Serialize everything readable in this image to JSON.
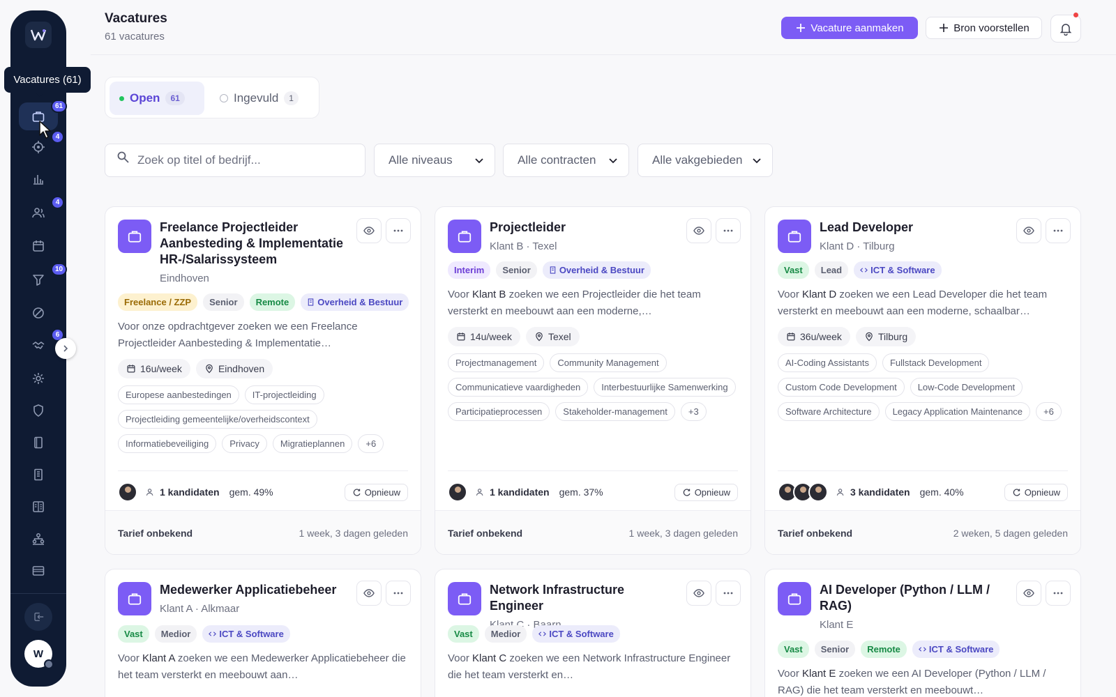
{
  "tooltip": "Vacatures (61)",
  "sidebar": {
    "logo_icon": "w-logo-icon",
    "items": [
      {
        "name": "briefcase-icon",
        "badge": "61",
        "active": true
      },
      {
        "name": "target-icon",
        "badge": "4"
      },
      {
        "name": "chart-icon",
        "badge": ""
      },
      {
        "name": "users-icon",
        "badge": "4"
      },
      {
        "name": "calendar-icon",
        "badge": ""
      },
      {
        "name": "filter-icon",
        "badge": "10"
      },
      {
        "name": "ban-icon",
        "badge": ""
      },
      {
        "name": "handshake-icon",
        "badge": "6"
      },
      {
        "name": "gear-icon",
        "badge": ""
      },
      {
        "name": "shield-icon",
        "badge": ""
      },
      {
        "name": "book-icon",
        "badge": ""
      },
      {
        "name": "building-icon",
        "badge": ""
      },
      {
        "name": "document-icon",
        "badge": ""
      },
      {
        "name": "org-icon",
        "badge": ""
      },
      {
        "name": "card-icon",
        "badge": ""
      }
    ],
    "avatar_letter": "W"
  },
  "header": {
    "title": "Vacatures",
    "subtitle": "61 vacatures",
    "primary_button": "Vacature aanmaken",
    "secondary_button": "Bron voorstellen"
  },
  "tabs": [
    {
      "label": "Open",
      "count": "61"
    },
    {
      "label": "Ingevuld",
      "count": "1"
    }
  ],
  "filters": {
    "search_placeholder": "Zoek op titel of bedrijf...",
    "level": "Alle niveaus",
    "contract": "Alle contracten",
    "domain": "Alle vakgebieden"
  },
  "cards": [
    {
      "title": "Freelance Projectleider Aanbesteding & Implementatie HR-/Salarissysteem",
      "subtitle": "Eindhoven",
      "tags": [
        "Freelance / ZZP",
        "Senior",
        "Remote",
        "Overheid & Bestuur"
      ],
      "desc_prefix": "Voor onze opdrachtgever zoeken we een Freelance Projectleider Aanbesteding & Implementatie…",
      "hours": "16u/week",
      "location": "Eindhoven",
      "skills": [
        "Europese aanbestedingen",
        "IT-projectleiding",
        "Projectleiding gemeentelijke/overheidscontext",
        "Informatiebeveiliging",
        "Privacy",
        "Migratieplannen",
        "+6"
      ],
      "candidates": "1 kandidaten",
      "avg": "gem. 49%",
      "retry": "Opnieuw",
      "tarief": "Tarief onbekend",
      "ago": "1 week, 3 dagen geleden"
    },
    {
      "title": "Projectleider",
      "subtitle": "Klant B · Texel",
      "tags": [
        "Interim",
        "Senior",
        "Overheid & Bestuur"
      ],
      "desc_lead": "Voor ",
      "desc_client": "Klant B",
      "desc_rest": " zoeken we een Projectleider die het team versterkt en meebouwt aan een moderne,…",
      "hours": "14u/week",
      "location": "Texel",
      "skills": [
        "Projectmanagement",
        "Community Management",
        "Communicatieve vaardigheden",
        "Interbestuurlijke Samenwerking",
        "Participatieprocessen",
        "Stakeholder-management",
        "+3"
      ],
      "candidates": "1 kandidaten",
      "avg": "gem. 37%",
      "retry": "Opnieuw",
      "tarief": "Tarief onbekend",
      "ago": "1 week, 3 dagen geleden"
    },
    {
      "title": "Lead Developer",
      "subtitle": "Klant D · Tilburg",
      "tags": [
        "Vast",
        "Lead",
        "ICT & Software"
      ],
      "desc_lead": "Voor ",
      "desc_client": "Klant D",
      "desc_rest": " zoeken we een Lead Developer die het team versterkt en meebouwt aan een moderne, schaalbar…",
      "hours": "36u/week",
      "location": "Tilburg",
      "skills": [
        "AI-Coding Assistants",
        "Fullstack Development",
        "Custom Code Development",
        "Low-Code Development",
        "Software Architecture",
        "Legacy Application Maintenance",
        "+6"
      ],
      "candidates": "3 kandidaten",
      "avg": "gem. 40%",
      "retry": "Opnieuw",
      "tarief": "Tarief onbekend",
      "ago": "2 weken, 5 dagen geleden"
    },
    {
      "title": "Medewerker Applicatiebeheer",
      "subtitle": "Klant A · Alkmaar",
      "tags": [
        "Vast",
        "Medior",
        "ICT & Software"
      ],
      "desc_lead": "Voor ",
      "desc_client": "Klant A",
      "desc_rest": " zoeken we een Medewerker Applicatiebeheer die het team versterkt en meebouwt aan…"
    },
    {
      "title": "Network Infrastructure Engineer",
      "subtitle": "Klant C · Baarn",
      "tags": [
        "Vast",
        "Medior",
        "ICT & Software"
      ],
      "desc_lead": "Voor ",
      "desc_client": "Klant C",
      "desc_rest": " zoeken we een Network Infrastructure Engineer die het team versterkt en…"
    },
    {
      "title": "AI Developer (Python / LLM / RAG)",
      "subtitle": "Klant E",
      "tags": [
        "Vast",
        "Senior",
        "Remote",
        "ICT & Software"
      ],
      "desc_lead": "Voor ",
      "desc_client": "Klant E",
      "desc_rest": " zoeken we een AI Developer (Python / LLM / RAG) die het team versterkt en meebouwt…"
    }
  ],
  "colors": {
    "accent": "#7c5cf5",
    "sidebar": "#0f1b33",
    "badge": "#5b5cf0"
  }
}
